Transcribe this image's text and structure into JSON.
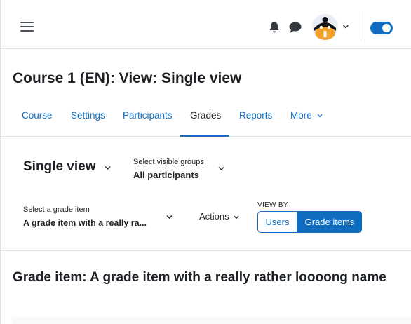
{
  "navbar": {
    "menu_icon": "hamburger-icon",
    "notifications_icon": "bell-icon",
    "messages_icon": "chat-bubble-icon",
    "user_avatar": "avatar",
    "edit_mode_toggle": "toggle-on",
    "accent_color": "#0f6cbf"
  },
  "page": {
    "title": "Course 1 (EN): View: Single view"
  },
  "tabs": [
    {
      "label": "Course",
      "active": false
    },
    {
      "label": "Settings",
      "active": false
    },
    {
      "label": "Participants",
      "active": false
    },
    {
      "label": "Grades",
      "active": true
    },
    {
      "label": "Reports",
      "active": false
    },
    {
      "label": "More",
      "active": false
    }
  ],
  "tertiary": {
    "report_selector": "Single view",
    "groups_label": "Select visible groups",
    "groups_value": "All participants",
    "grade_item_label": "Select a grade item",
    "grade_item_value": "A grade item with a really ra...",
    "actions_label": "Actions",
    "view_by_label": "VIEW BY",
    "view_by_options": [
      "Users",
      "Grade items"
    ],
    "view_by_selected": "Grade items"
  },
  "content": {
    "heading": "Grade item: A grade item with a really rather loooong name"
  }
}
